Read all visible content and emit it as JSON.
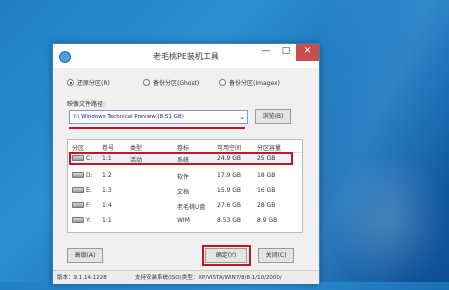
{
  "window": {
    "title": "老毛桃PE装机工具"
  },
  "title_buttons": {
    "minimize": "—",
    "maximize": "□",
    "close": "✕"
  },
  "modes": [
    {
      "label": "还原分区(R)",
      "selected": true
    },
    {
      "label": "备份分区(Ghost)",
      "selected": false
    },
    {
      "label": "备份分区(Imagex)",
      "selected": false
    }
  ],
  "image_path": {
    "label": "映像文件路径:",
    "value": "I:\\ Windows Technical Preview (8.51 GB)",
    "browse_label": "浏览(B)"
  },
  "table": {
    "headers": [
      "分区",
      "卷号",
      "类型",
      "卷标",
      "可用空间",
      "分区容量"
    ],
    "rows": [
      [
        "C:",
        "1:1",
        "活动",
        "系统",
        "24.9 GB",
        "25 GB"
      ],
      [
        "D:",
        "1:2",
        "",
        "软件",
        "17.9 GB",
        "18 GB"
      ],
      [
        "E:",
        "1:3",
        "",
        "文档",
        "15.9 GB",
        "16 GB"
      ],
      [
        "F:",
        "1:4",
        "",
        "老毛桃U盘",
        "27.6 GB",
        "28 GB"
      ],
      [
        "Y:",
        "1:1",
        "",
        "WIM",
        "8.53 GB",
        "8.9 GB"
      ]
    ]
  },
  "buttons": {
    "advanced": "高级(A)",
    "ok": "确定(Y)",
    "close": "关闭(C)"
  },
  "status": {
    "version": "版本：9.1.14.1228",
    "support": "支持安装系统(ISO)类型：XP/VISTA/WIN7/8/8.1/10/2000/"
  },
  "colors": {
    "highlight": "#c8141e",
    "desktop": "#1f7fc4"
  }
}
